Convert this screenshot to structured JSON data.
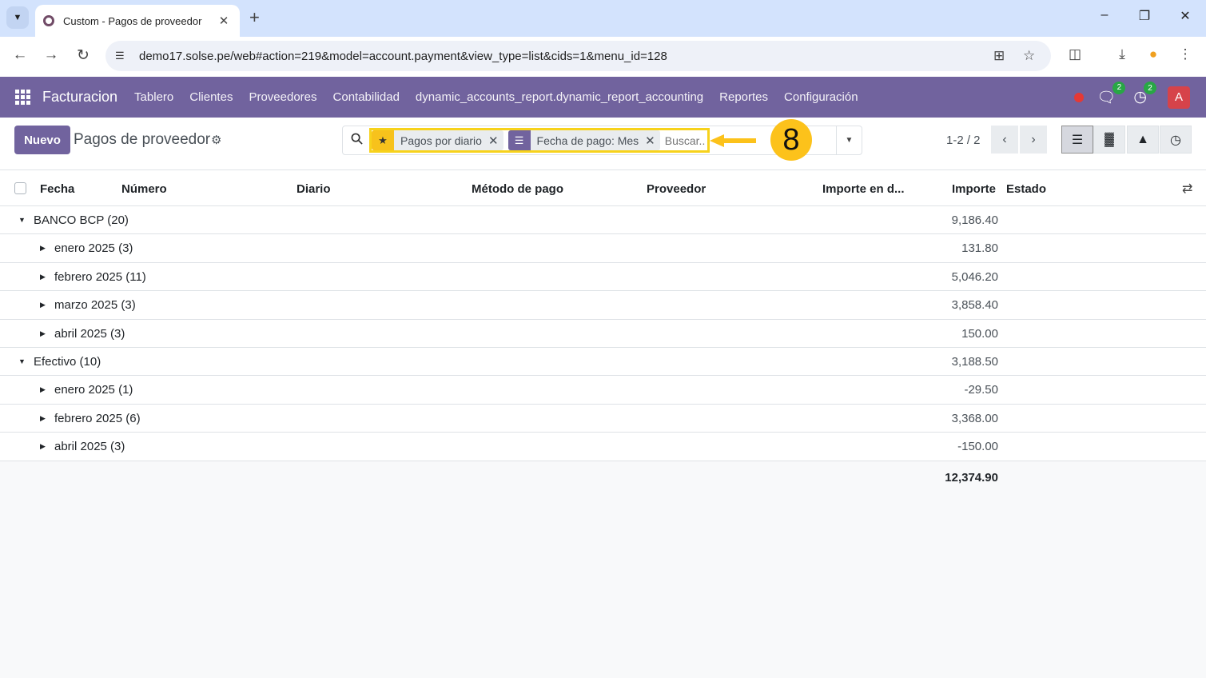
{
  "browser": {
    "tab_title": "Custom - Pagos de proveedor",
    "url": "demo17.solse.pe/web#action=219&model=account.payment&view_type=list&cids=1&menu_id=128"
  },
  "navbar": {
    "brand": "Facturacion",
    "menu": [
      "Tablero",
      "Clientes",
      "Proveedores",
      "Contabilidad",
      "dynamic_accounts_report.dynamic_report_accounting",
      "Reportes",
      "Configuración"
    ],
    "messages_badge": "2",
    "activities_badge": "2",
    "avatar_letter": "A"
  },
  "control_panel": {
    "new_button": "Nuevo",
    "title": "Pagos de proveedor",
    "facets": [
      {
        "icon": "star-icon",
        "label": "Pagos por diario"
      },
      {
        "icon": "layers-icon",
        "label": "Fecha de pago: Mes"
      }
    ],
    "search_placeholder": "Buscar...",
    "step_number": "8",
    "pager": "1-2 / 2"
  },
  "table": {
    "columns": [
      "Fecha",
      "Número",
      "Diario",
      "Método de pago",
      "Proveedor",
      "Importe en d...",
      "Importe",
      "Estado"
    ],
    "rows": [
      {
        "level": 0,
        "label": "BANCO BCP (20)",
        "amount": "9,186.40",
        "expanded": true
      },
      {
        "level": 1,
        "label": "enero 2025 (3)",
        "amount": "131.80",
        "expanded": false
      },
      {
        "level": 1,
        "label": "febrero 2025 (11)",
        "amount": "5,046.20",
        "expanded": false
      },
      {
        "level": 1,
        "label": "marzo 2025 (3)",
        "amount": "3,858.40",
        "expanded": false
      },
      {
        "level": 1,
        "label": "abril 2025 (3)",
        "amount": "150.00",
        "expanded": false
      },
      {
        "level": 0,
        "label": "Efectivo (10)",
        "amount": "3,188.50",
        "expanded": true
      },
      {
        "level": 1,
        "label": "enero 2025 (1)",
        "amount": "-29.50",
        "expanded": false
      },
      {
        "level": 1,
        "label": "febrero 2025 (6)",
        "amount": "3,368.00",
        "expanded": false
      },
      {
        "level": 1,
        "label": "abril 2025 (3)",
        "amount": "-150.00",
        "expanded": false
      }
    ],
    "total": "12,374.90"
  },
  "colors": {
    "navbar": "#71639e",
    "highlight": "#f7d21c",
    "step_badge": "#fcc21b"
  }
}
